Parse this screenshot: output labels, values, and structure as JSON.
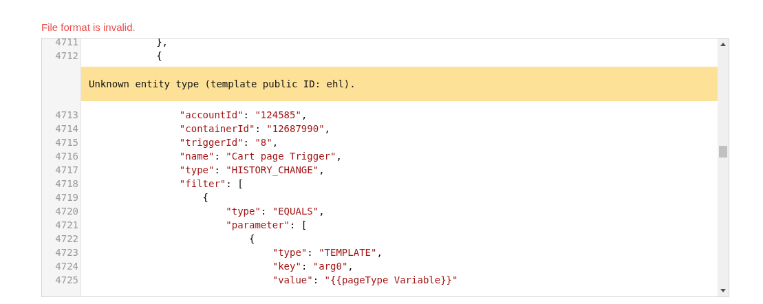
{
  "error_message": "File format is invalid.",
  "editor": {
    "lines": [
      {
        "kind": "code",
        "number": "4711",
        "text": "            },"
      },
      {
        "kind": "code",
        "number": "4712",
        "text": "            {"
      },
      {
        "kind": "warning",
        "text": "Unknown entity type (template public ID: ehl)."
      },
      {
        "kind": "code",
        "number": "4713",
        "text": "                \"accountId\": \"124585\","
      },
      {
        "kind": "code",
        "number": "4714",
        "text": "                \"containerId\": \"12687990\","
      },
      {
        "kind": "code",
        "number": "4715",
        "text": "                \"triggerId\": \"8\","
      },
      {
        "kind": "code",
        "number": "4716",
        "text": "                \"name\": \"Cart page Trigger\","
      },
      {
        "kind": "code",
        "number": "4717",
        "text": "                \"type\": \"HISTORY_CHANGE\","
      },
      {
        "kind": "code",
        "number": "4718",
        "text": "                \"filter\": ["
      },
      {
        "kind": "code",
        "number": "4719",
        "text": "                    {"
      },
      {
        "kind": "code",
        "number": "4720",
        "text": "                        \"type\": \"EQUALS\","
      },
      {
        "kind": "code",
        "number": "4721",
        "text": "                        \"parameter\": ["
      },
      {
        "kind": "code",
        "number": "4722",
        "text": "                            {"
      },
      {
        "kind": "code",
        "number": "4723",
        "text": "                                \"type\": \"TEMPLATE\","
      },
      {
        "kind": "code",
        "number": "4724",
        "text": "                                \"key\": \"arg0\","
      },
      {
        "kind": "code",
        "number": "4725",
        "text": "                                \"value\": \"{{pageType Variable}}\""
      }
    ]
  }
}
